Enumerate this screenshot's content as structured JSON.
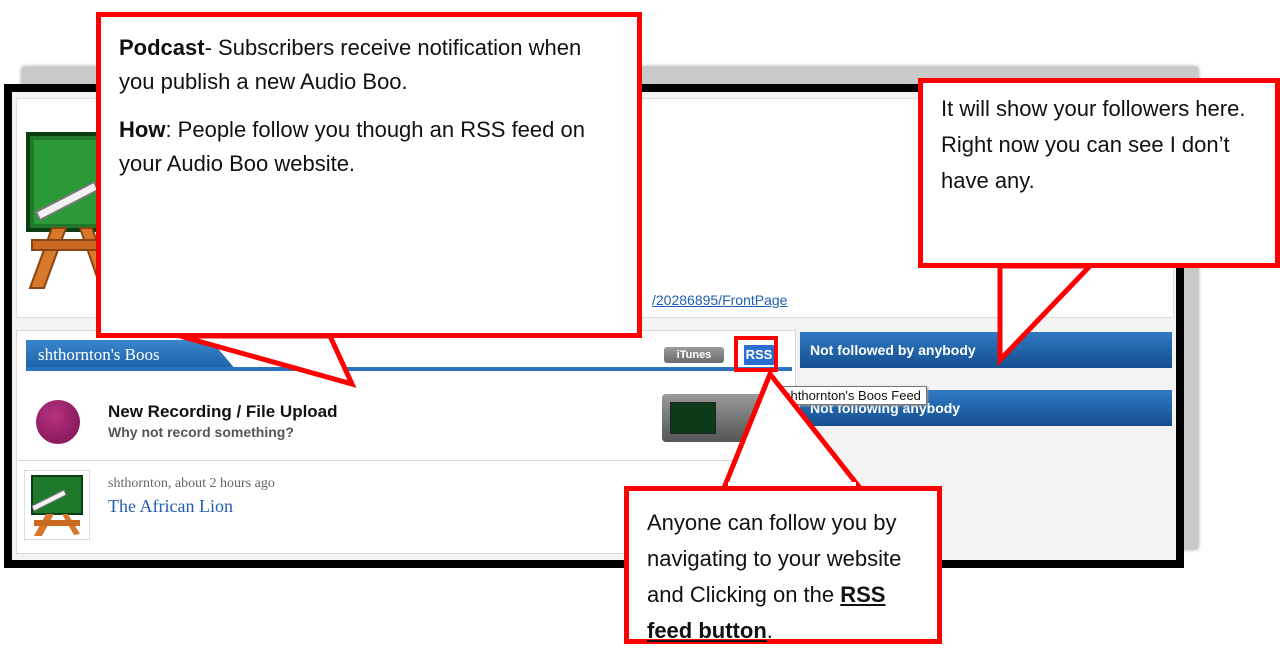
{
  "profile": {
    "url_fragment": "/20286895/FrontPage"
  },
  "boos": {
    "tab_title": "shthornton's Boos",
    "itunes_label": "iTunes",
    "rss_label": "RSS",
    "rss_tooltip": "shthornton's Boos Feed",
    "new_recording": {
      "title": "New Recording / File Upload",
      "subtitle": "Why not record something?"
    },
    "entries": [
      {
        "author_time": "shthornton, about 2 hours ago",
        "title": "The African Lion"
      }
    ]
  },
  "followers": {
    "followed_label": "Not followed by anybody",
    "following_label": "Not following anybody"
  },
  "callouts": {
    "podcast": {
      "heading": "Podcast",
      "body": "- Subscribers receive notification when you publish a new Audio Boo.",
      "how_heading": "How",
      "how_body": ": People follow you though an RSS feed on your Audio Boo website."
    },
    "followers": {
      "text": "It will show your followers here. Right now you can see I don’t have any."
    },
    "rss": {
      "text_before": "Anyone can follow you by navigating to your website and Clicking on the ",
      "link_text": "RSS feed button",
      "text_after": "."
    }
  },
  "colors": {
    "callout_border": "#ff0000",
    "tab_blue": "#2a73c0",
    "link_blue": "#1f5fae",
    "avatar_purple": "#9b1f68"
  }
}
